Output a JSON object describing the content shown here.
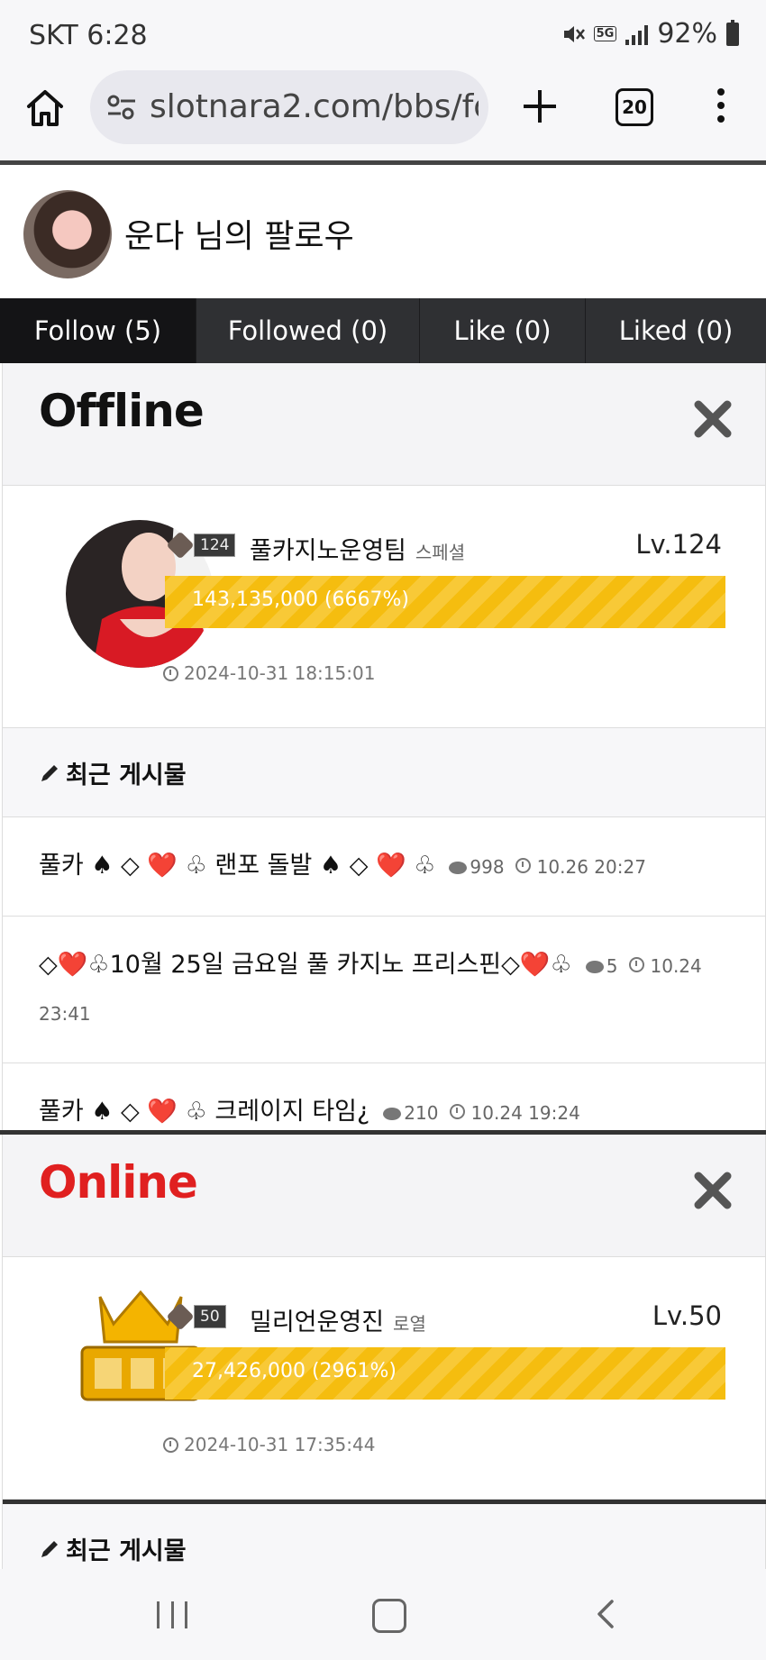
{
  "status_bar": {
    "carrier_time": "SKT 6:28",
    "network": "5G",
    "battery": "92%"
  },
  "browser": {
    "url": "slotnara2.com/bbs/fo",
    "tab_count": "20"
  },
  "profile": {
    "title": "운다 님의 팔로우"
  },
  "tabs": [
    {
      "label": "Follow (5)",
      "active": true
    },
    {
      "label": "Followed (0)",
      "active": false
    },
    {
      "label": "Like (0)",
      "active": false
    },
    {
      "label": "Liked (0)",
      "active": false
    }
  ],
  "cards": [
    {
      "state": "Offline",
      "state_color": "#111111",
      "member": {
        "badge_level": "124",
        "name": "풀카지노운영팀",
        "grade": "스페셜",
        "level": "Lv.124",
        "points": "143,135,000 (6667%)",
        "last_seen": "2024-10-31 18:15:01"
      },
      "recent_label": "최근 게시물",
      "posts": [
        {
          "title": "풀카 ♠ ◇ ❤️ ♧ 랜포 돌발 ♠ ◇ ❤️ ♧",
          "comments": "998",
          "date": "10.26 20:27"
        },
        {
          "title": "◇❤️♧10월 25일 금요일 풀 카지노 프리스핀◇❤️♧",
          "comments": "5",
          "date": "10.24 23:41"
        },
        {
          "title": "풀카 ♠ ◇ ❤️ ♧ 크레이지 타임¿",
          "comments": "210",
          "date": "10.24 19:24"
        }
      ]
    },
    {
      "state": "Online",
      "state_color": "#e02020",
      "member": {
        "badge_level": "50",
        "name": "밀리언운영진",
        "grade": "로열",
        "level": "Lv.50",
        "points": "27,426,000 (2961%)",
        "last_seen": "2024-10-31 17:35:44"
      },
      "recent_label": "최근 게시물"
    }
  ]
}
